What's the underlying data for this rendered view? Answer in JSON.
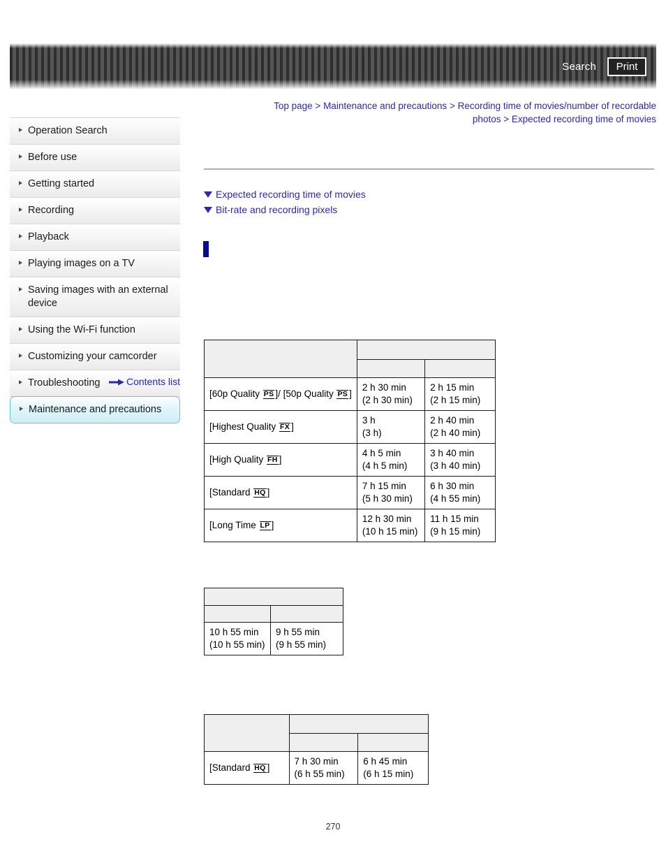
{
  "header": {
    "search_label": "Search",
    "print_label": "Print"
  },
  "breadcrumb": {
    "items": [
      "Top page",
      "Maintenance and precautions",
      "Recording time of movies/number of recordable photos",
      "Expected recording time of movies"
    ],
    "separator": ">"
  },
  "sidebar": {
    "items": [
      {
        "label": "Operation Search",
        "selected": false
      },
      {
        "label": "Before use",
        "selected": false
      },
      {
        "label": "Getting started",
        "selected": false
      },
      {
        "label": "Recording",
        "selected": false
      },
      {
        "label": "Playback",
        "selected": false
      },
      {
        "label": "Playing images on a TV",
        "selected": false
      },
      {
        "label": "Saving images with an external device",
        "selected": false
      },
      {
        "label": "Using the Wi-Fi function",
        "selected": false
      },
      {
        "label": "Customizing your camcorder",
        "selected": false
      },
      {
        "label": "Troubleshooting",
        "selected": false
      },
      {
        "label": "Maintenance and precautions",
        "selected": true
      }
    ],
    "contents_list_label": "Contents list"
  },
  "anchors": [
    {
      "label": "Expected recording time of movies"
    },
    {
      "label": "Bit-rate and recording pixels"
    }
  ],
  "tables": {
    "table_1": {
      "header_span": "",
      "header_sub_1": "",
      "header_sub_2": "",
      "header_corner": "",
      "rows": [
        {
          "label_pre": "[60p Quality ",
          "mode": "PS",
          "label_mid": "]/ [50p Quality ",
          "mode2": "PS",
          "label_post": "]",
          "col1_line1": "2 h 30 min",
          "col1_line2": "(2 h 30 min)",
          "col2_line1": "2 h 15 min",
          "col2_line2": "(2 h 15 min)"
        },
        {
          "label_pre": "[Highest Quality ",
          "mode": "FX",
          "label_post": "]",
          "col1_line1": "3 h",
          "col1_line2": "(3 h)",
          "col2_line1": "2 h 40 min",
          "col2_line2": "(2 h 40 min)"
        },
        {
          "label_pre": "[High Quality ",
          "mode": "FH",
          "label_post": "]",
          "col1_line1": "4 h 5 min",
          "col1_line2": "(4 h 5 min)",
          "col2_line1": "3 h 40 min",
          "col2_line2": "(3 h 40 min)"
        },
        {
          "label_pre": "[Standard ",
          "mode": "HQ",
          "label_post": "]",
          "col1_line1": "7 h 15 min",
          "col1_line2": "(5 h 30 min)",
          "col2_line1": "6 h 30 min",
          "col2_line2": "(4 h 55 min)"
        },
        {
          "label_pre": "[Long Time ",
          "mode": "LP",
          "label_post": "]",
          "col1_line1": "12 h 30 min",
          "col1_line2": "(10 h 15 min)",
          "col2_line1": "11 h 15 min",
          "col2_line2": "(9 h 15 min)"
        }
      ]
    },
    "table_2": {
      "header_span": "",
      "header_sub_1": "",
      "header_sub_2": "",
      "rows": [
        {
          "col1_line1": "10 h 55 min",
          "col1_line2": "(10 h 55 min)",
          "col2_line1": "9 h 55 min",
          "col2_line2": "(9 h 55 min)"
        }
      ]
    },
    "table_3": {
      "header_span": "",
      "header_sub_1": "",
      "header_sub_2": "",
      "header_corner": "",
      "rows": [
        {
          "label_pre": "[Standard ",
          "mode": "HQ",
          "label_post": "]",
          "col1_line1": "7 h 30 min",
          "col1_line2": "(6 h 55 min)",
          "col2_line1": "6 h 45 min",
          "col2_line2": "(6 h 15 min)"
        }
      ]
    }
  },
  "footer": {
    "page_number": "270"
  },
  "colors": {
    "link": "#2a2aa8",
    "selected_nav_border": "#62c7dd",
    "section_marker": "#0b0b8e",
    "table_header_bg": "#efefef"
  }
}
